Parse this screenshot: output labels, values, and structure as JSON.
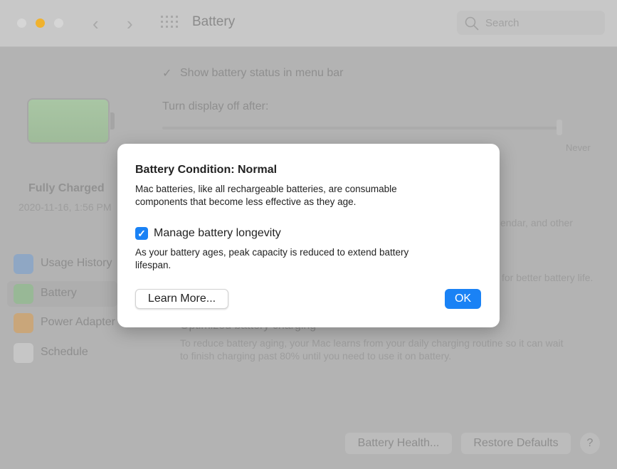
{
  "window": {
    "title": "Battery",
    "search_placeholder": "Search"
  },
  "colors": {
    "accent": "#1a82f5",
    "close": "#d6d6d6",
    "minimize": "#f0b22e",
    "zoom": "#d6d6d6"
  },
  "battery": {
    "status": "Fully Charged",
    "timestamp": "2020-11-16, 1:56 PM",
    "level_percent": 100
  },
  "main": {
    "show_status_label": "Show battery status in menu bar",
    "display_off_label": "Turn display off after:",
    "slider_end_label": "Never",
    "fragment1": "endar, and other",
    "fragment2": "for better battery life.",
    "optimized_label": "Optimized battery charging",
    "optimized_desc1": "To reduce battery aging, your Mac learns from your daily charging routine so it can wait",
    "optimized_desc2": "to finish charging past 80% until you need to use it on battery."
  },
  "sidebar": {
    "items": [
      {
        "label": "Usage History",
        "icon": "bar-chart-icon"
      },
      {
        "label": "Battery",
        "icon": "battery-icon"
      },
      {
        "label": "Power Adapter",
        "icon": "bolt-icon"
      },
      {
        "label": "Schedule",
        "icon": "calendar-icon"
      }
    ]
  },
  "footer": {
    "battery_health": "Battery Health...",
    "restore_defaults": "Restore Defaults",
    "help": "?"
  },
  "dialog": {
    "title": "Battery Condition: Normal",
    "description": "Mac batteries, like all rechargeable batteries, are consumable components that become less effective as they age.",
    "checkbox_label": "Manage battery longevity",
    "checkbox_checked": true,
    "checkbox_desc": "As your battery ages, peak capacity is reduced to extend battery lifespan.",
    "learn_more": "Learn More...",
    "ok": "OK"
  }
}
